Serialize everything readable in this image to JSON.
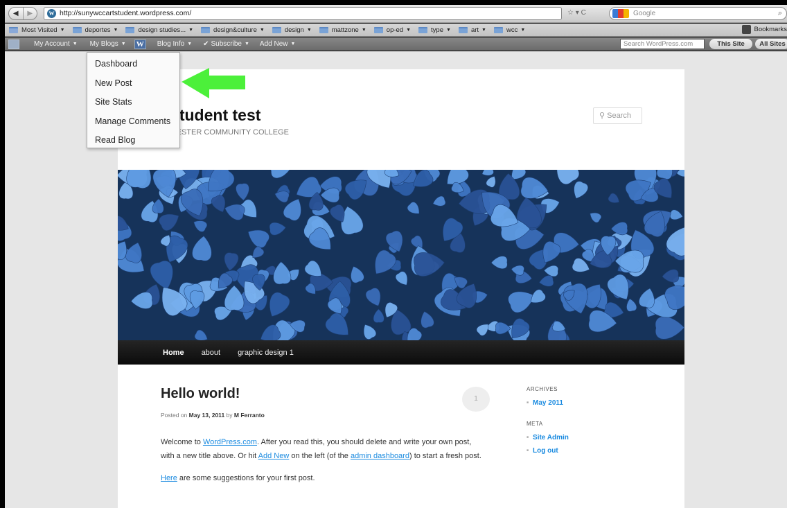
{
  "browser": {
    "url": "http://sunywccartstudent.wordpress.com/",
    "search_placeholder": "Google",
    "bookmarks": [
      {
        "label": "Most Visited",
        "menu": true,
        "icon": "most-visited-icon"
      },
      {
        "label": "deportes",
        "menu": true
      },
      {
        "label": "design studies...",
        "menu": true
      },
      {
        "label": "design&culture",
        "menu": true
      },
      {
        "label": "design",
        "menu": true
      },
      {
        "label": "mattzone",
        "menu": true
      },
      {
        "label": "op-ed",
        "menu": true
      },
      {
        "label": "type",
        "menu": true
      },
      {
        "label": "art",
        "menu": true
      },
      {
        "label": "wcc",
        "menu": true
      }
    ],
    "bookmarks_right": "Bookmarks"
  },
  "adminbar": {
    "my_account": "My Account",
    "my_blogs": "My Blogs",
    "blog_info": "Blog Info",
    "subscribe": "Subscribe",
    "add_new": "Add New",
    "search_placeholder": "Search WordPress.com",
    "this_site": "This Site",
    "all_sites": "All Sites"
  },
  "dropdown": [
    "Dashboard",
    "New Post",
    "Site Stats",
    "Manage Comments",
    "Read Blog"
  ],
  "site": {
    "title_visible": "t student test",
    "description_visible": "TCHESTER COMMUNITY COLLEGE",
    "search_placeholder": "Search",
    "nav": [
      "Home",
      "about",
      "graphic design 1"
    ]
  },
  "post": {
    "title": "Hello world!",
    "comment_count": "1",
    "posted_on_prefix": "Posted on",
    "date": "May 13, 2011",
    "by": "by",
    "author": "M Ferranto",
    "p1_a": "Welcome to ",
    "p1_link1": "WordPress.com",
    "p1_b": ". After you read this, you should delete and write your own post, with a new title above. Or hit ",
    "p1_link2": "Add New",
    "p1_c": " on the left (of the ",
    "p1_link3": "admin dashboard",
    "p1_d": ") to start a fresh post.",
    "p2_link": "Here",
    "p2_rest": " are some suggestions for your first post."
  },
  "sidebar": {
    "archives_title": "ARCHIVES",
    "archives": [
      "May 2011"
    ],
    "meta_title": "META",
    "meta": [
      "Site Admin",
      "Log out"
    ]
  },
  "colors": {
    "link": "#1b8be0",
    "highlight_arrow": "#4cf03a"
  }
}
